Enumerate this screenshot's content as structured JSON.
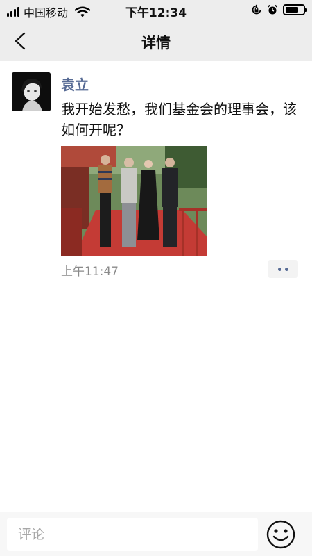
{
  "status_bar": {
    "carrier": "中国移动",
    "time": "下午12:34"
  },
  "nav": {
    "title": "详情"
  },
  "post": {
    "author": "袁立",
    "text": "我开始发愁，我们基金会的理事会，该如何开呢？",
    "time": "上午11:47"
  },
  "comment": {
    "placeholder": "评论"
  },
  "icons": {
    "back": "chevron-left-icon",
    "more": "more-dots-icon",
    "emoji": "smiley-face-icon"
  },
  "colors": {
    "author_name": "#576b95",
    "bar_background": "#ededed",
    "timestamp": "#8a8a8a"
  }
}
